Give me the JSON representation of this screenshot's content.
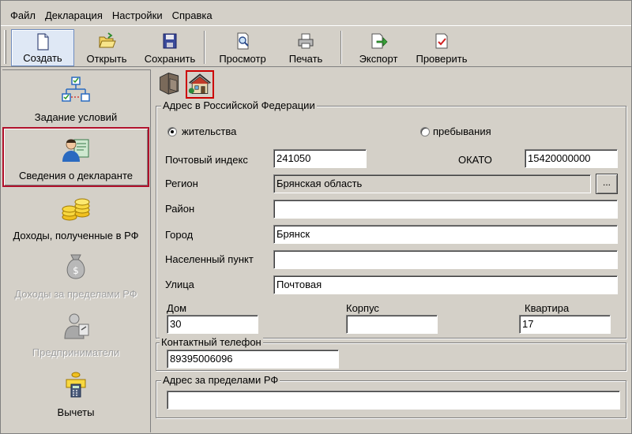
{
  "menu": [
    "Файл",
    "Декларация",
    "Настройки",
    "Справка"
  ],
  "toolbar": {
    "create": "Создать",
    "open": "Открыть",
    "save": "Сохранить",
    "preview": "Просмотр",
    "print": "Печать",
    "export": "Экспорт",
    "check": "Проверить"
  },
  "nav": {
    "conditions": "Задание условий",
    "declarant": "Сведения о декларанте",
    "income_rf": "Доходы, полученные в РФ",
    "income_abroad": "Доходы за пределами РФ",
    "entrepreneurs": "Предприниматели",
    "deductions": "Вычеты"
  },
  "address_rf": {
    "title": "Адрес в Российской Федерации",
    "radio_residence": "жительства",
    "radio_stay": "пребывания",
    "postal_label": "Почтовый индекс",
    "postal_value": "241050",
    "okato_label": "ОКАТО",
    "okato_value": "15420000000",
    "region_label": "Регион",
    "region_value": "Брянская область",
    "region_button": "...",
    "district_label": "Район",
    "district_value": "",
    "city_label": "Город",
    "city_value": "Брянск",
    "settlement_label": "Населенный пункт",
    "settlement_value": "",
    "street_label": "Улица",
    "street_value": "Почтовая",
    "house_label": "Дом",
    "house_value": "30",
    "building_label": "Корпус",
    "building_value": "",
    "flat_label": "Квартира",
    "flat_value": "17"
  },
  "phone": {
    "title": "Контактный телефон",
    "value": "89395006096"
  },
  "address_abroad": {
    "title": "Адрес за пределами РФ",
    "value": ""
  }
}
